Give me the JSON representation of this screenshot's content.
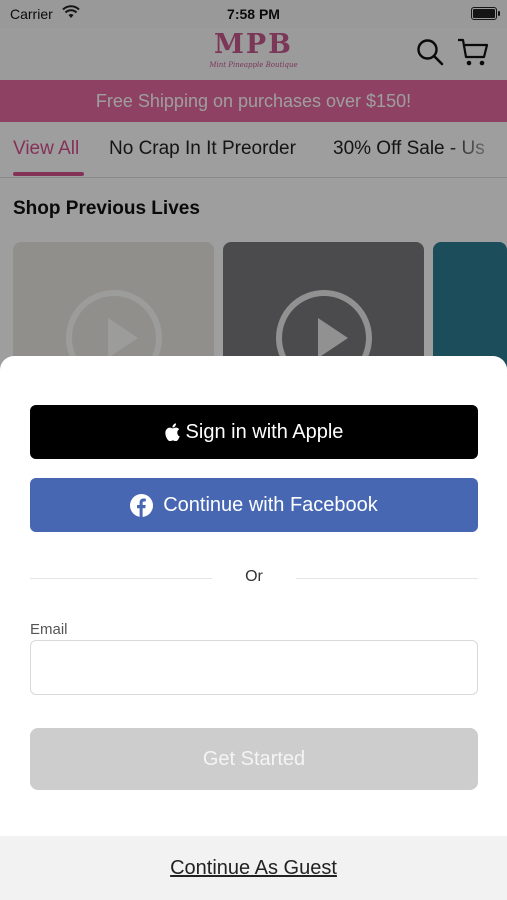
{
  "status_bar": {
    "carrier": "Carrier",
    "time": "7:58 PM"
  },
  "header": {
    "logo_mark": "MPB",
    "logo_sub": "Mint Pineapple Boutique"
  },
  "banner": {
    "text": "Free Shipping on purchases over $150!"
  },
  "tabs": [
    {
      "label": "View All"
    },
    {
      "label": "No Crap In It Preorder"
    },
    {
      "label": "30% Off Sale - Us"
    }
  ],
  "section": {
    "title": "Shop Previous Lives"
  },
  "modal": {
    "apple_label": "Sign in with Apple",
    "facebook_label": "Continue with Facebook",
    "or_label": "Or",
    "email_label": "Email",
    "email_value": "",
    "get_started_label": "Get Started",
    "guest_label": "Continue As Guest"
  },
  "colors": {
    "brand_pink": "#e56aa1",
    "facebook_blue": "#4767b3",
    "apple_black": "#000000"
  },
  "icons": [
    "wifi-icon",
    "battery-icon",
    "search-icon",
    "cart-icon",
    "apple-icon",
    "facebook-icon",
    "play-icon"
  ]
}
